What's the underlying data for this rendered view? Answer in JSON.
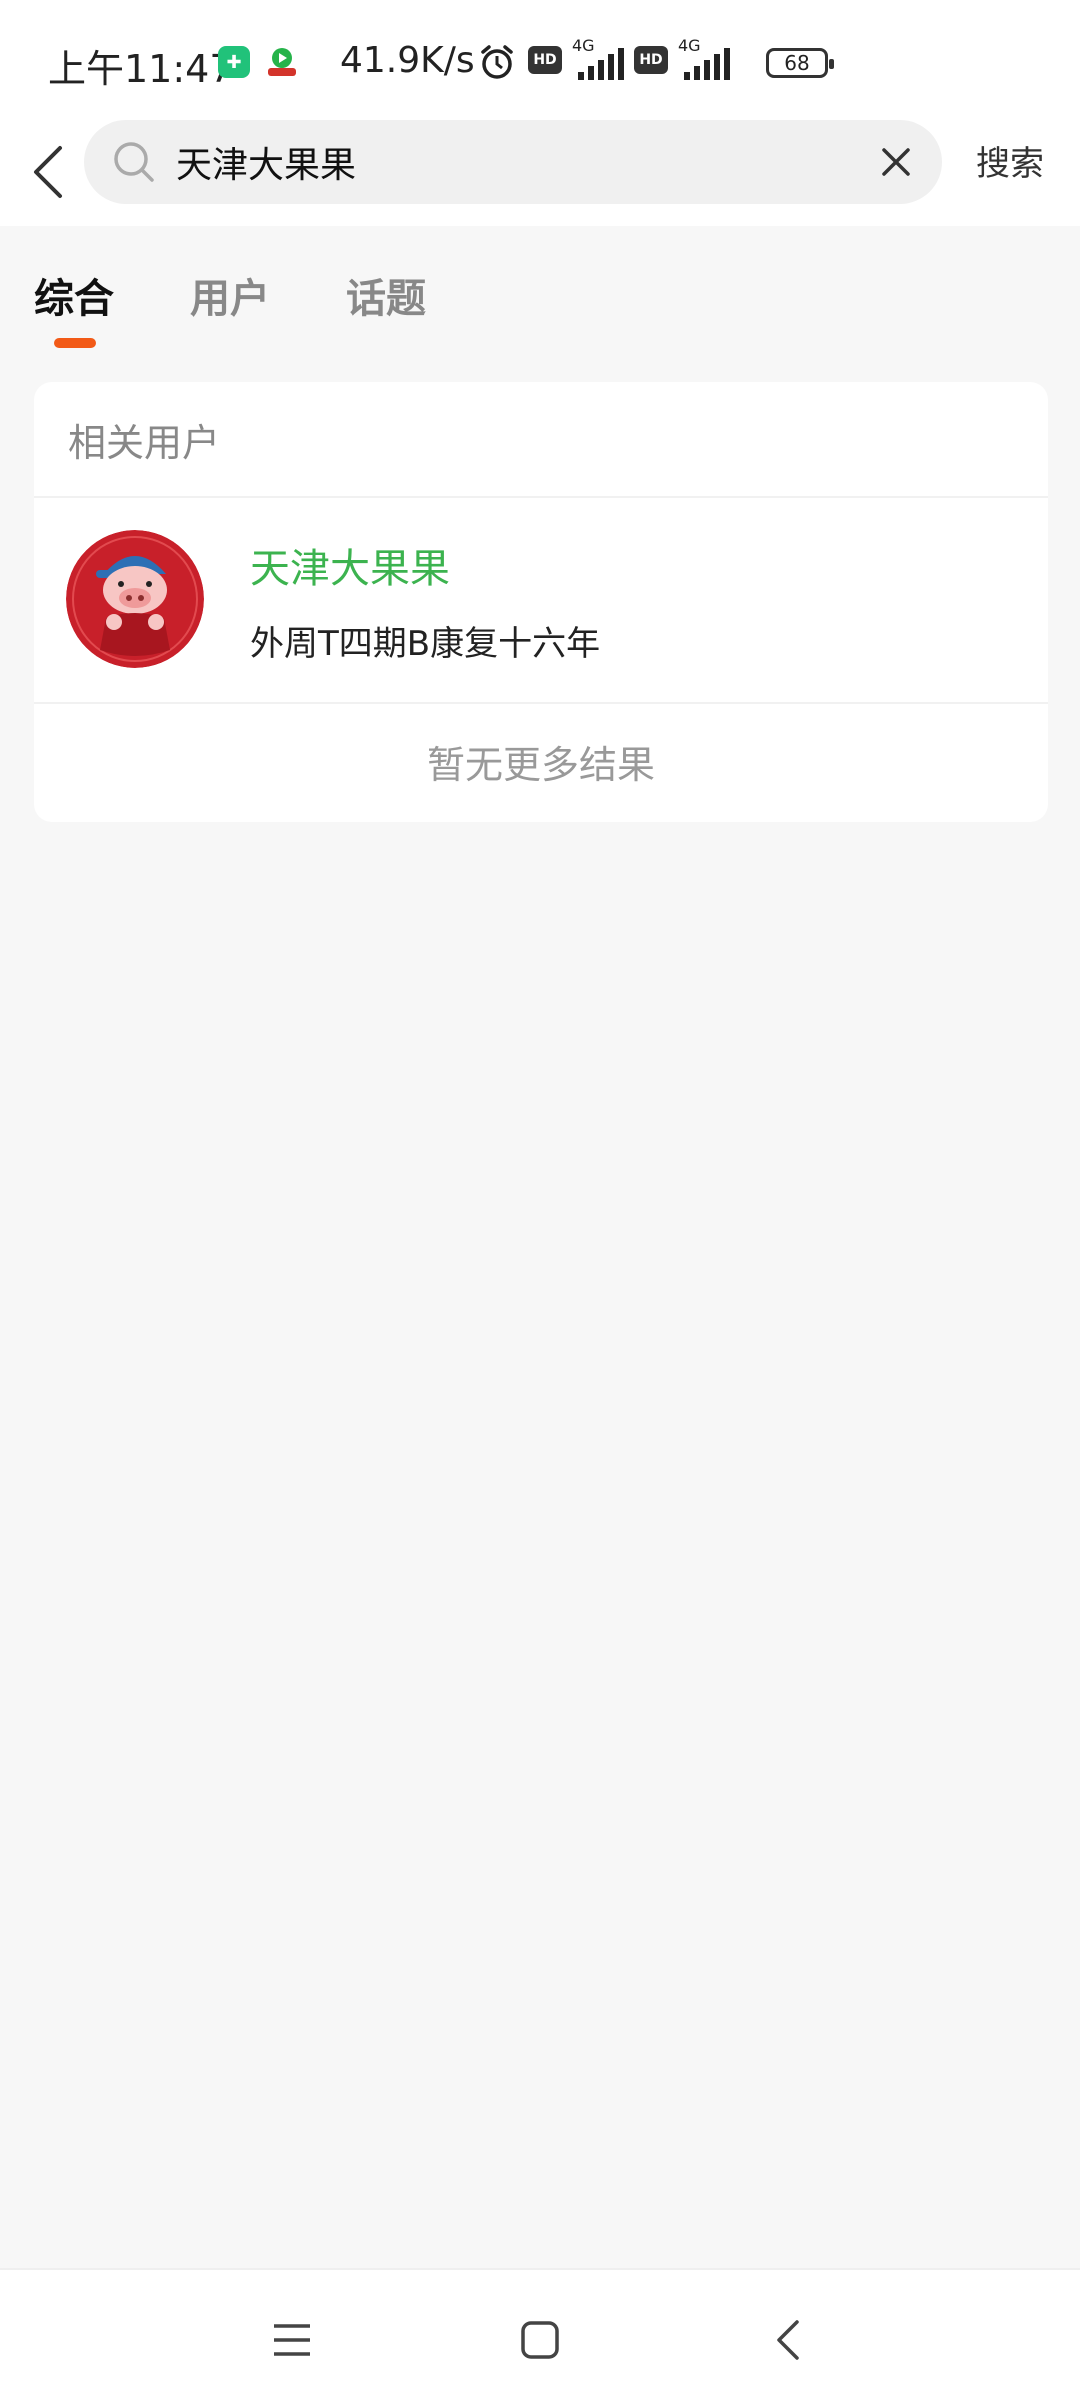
{
  "status_bar": {
    "time": "上午11:47",
    "net_speed": "41.9K/s",
    "hd1": "HD",
    "hd2": "HD",
    "sig1_label": "4G",
    "sig2_label": "4G",
    "battery": "68"
  },
  "search": {
    "query": "天津大果果",
    "button_label": "搜索"
  },
  "tabs": [
    {
      "label": "综合",
      "active": true
    },
    {
      "label": "用户",
      "active": false
    },
    {
      "label": "话题",
      "active": false
    }
  ],
  "results": {
    "section_title": "相关用户",
    "users": [
      {
        "name": "天津大果果",
        "description": "外周T四期B康复十六年"
      }
    ],
    "no_more_text": "暂无更多结果"
  },
  "colors": {
    "accent": "#f25a17",
    "username_green": "#3cb34f",
    "background": "#f7f7f7"
  },
  "icons": {
    "back": "chevron-left-icon",
    "search": "search-icon",
    "clear": "close-icon",
    "nav_menu": "menu-icon",
    "nav_home": "home-icon",
    "nav_back": "back-icon"
  }
}
